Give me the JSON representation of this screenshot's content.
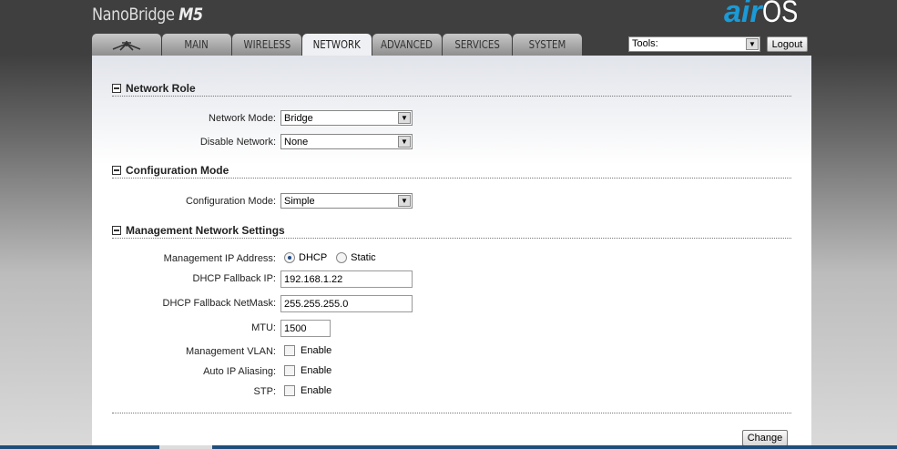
{
  "header": {
    "product": "NanoBridge",
    "model": "M5",
    "logo_air": "air",
    "logo_os": "OS"
  },
  "tabs": [
    {
      "label": "",
      "icon": "ubiquiti-logo-icon"
    },
    {
      "label": "MAIN"
    },
    {
      "label": "WIRELESS"
    },
    {
      "label": "NETWORK",
      "active": true
    },
    {
      "label": "ADVANCED"
    },
    {
      "label": "SERVICES"
    },
    {
      "label": "SYSTEM"
    }
  ],
  "tools": {
    "value": "Tools:",
    "logout": "Logout"
  },
  "sections": {
    "network_role": "Network Role",
    "config_mode": "Configuration Mode",
    "mgmt": "Management Network Settings"
  },
  "fields": {
    "network_mode": {
      "label": "Network Mode:",
      "value": "Bridge"
    },
    "disable_network": {
      "label": "Disable Network:",
      "value": "None"
    },
    "configuration_mode": {
      "label": "Configuration Mode:",
      "value": "Simple"
    },
    "mgmt_ip": {
      "label": "Management IP Address:",
      "opt1": "DHCP",
      "opt2": "Static",
      "selected": "DHCP"
    },
    "fallback_ip": {
      "label": "DHCP Fallback IP:",
      "value": "192.168.1.22"
    },
    "fallback_mask": {
      "label": "DHCP Fallback NetMask:",
      "value": "255.255.255.0"
    },
    "mtu": {
      "label": "MTU:",
      "value": "1500"
    },
    "mgmt_vlan": {
      "label": "Management VLAN:",
      "option": "Enable",
      "checked": false
    },
    "auto_ip": {
      "label": "Auto IP Aliasing:",
      "option": "Enable",
      "checked": false
    },
    "stp": {
      "label": "STP:",
      "option": "Enable",
      "checked": false
    }
  },
  "change_label": "Change",
  "colors": {
    "accent": "#1a9ad6"
  }
}
